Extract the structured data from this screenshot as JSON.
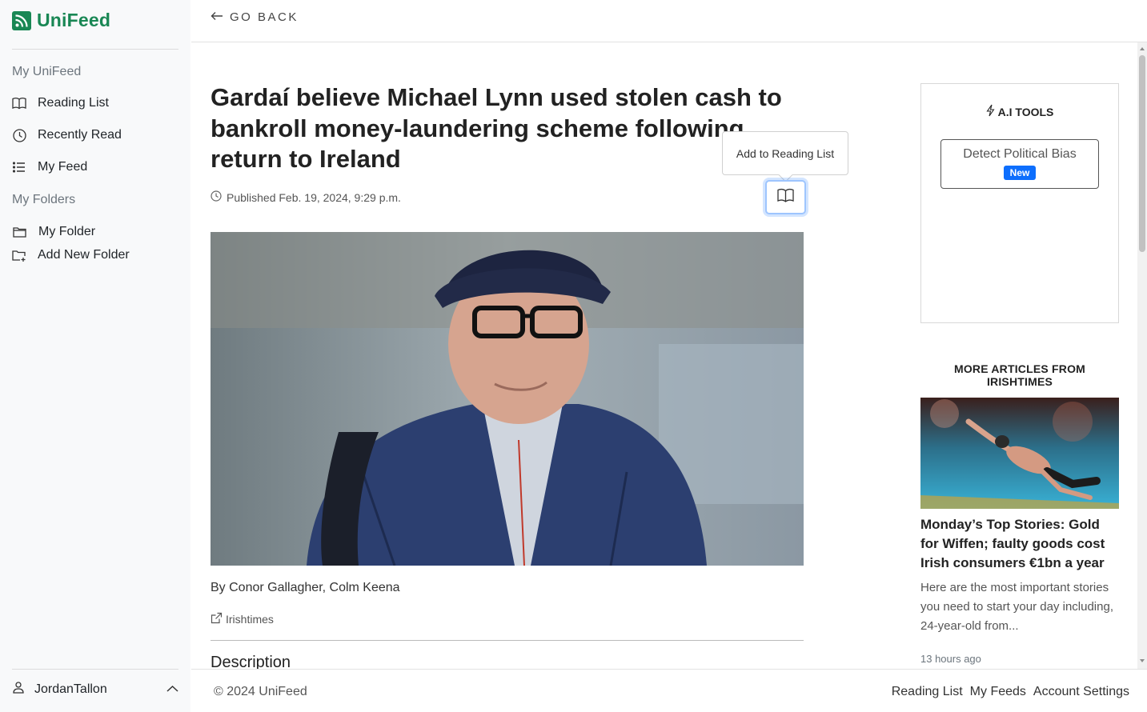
{
  "brand": {
    "name": "UniFeed",
    "color": "#198754",
    "icon": "rss-icon"
  },
  "sidebar": {
    "heading_unifeed": "My UniFeed",
    "items": [
      {
        "label": "Reading List",
        "icon": "book-icon"
      },
      {
        "label": "Recently Read",
        "icon": "clock-icon"
      },
      {
        "label": "My Feed",
        "icon": "list-icon"
      }
    ],
    "heading_folders": "My Folders",
    "folders": [
      {
        "label": "My Folder",
        "icon": "folder-icon"
      },
      {
        "label": "Add New Folder",
        "icon": "folder-plus-icon"
      }
    ],
    "user": {
      "name": "JordanTallon",
      "icon": "person-icon",
      "toggle_icon": "chevron-up-icon"
    }
  },
  "topbar": {
    "go_back": "GO BACK"
  },
  "article": {
    "title": "Gardaí believe Michael Lynn used stolen cash to bankroll money-laundering scheme following return to Ireland",
    "published": "Published Feb. 19, 2024, 9:29 p.m.",
    "tooltip": "Add to Reading List",
    "author": "By Conor Gallagher, Colm Keena",
    "source": "Irishtimes",
    "description_heading": "Description"
  },
  "ai_tools": {
    "title": "A.I TOOLS",
    "bias_button": "Detect Political Bias",
    "badge": "New",
    "badge_color": "#0d6efd"
  },
  "more": {
    "heading": "MORE ARTICLES FROM IRISHTIMES",
    "title": "Monday’s Top Stories: Gold for Wiffen; faulty goods cost Irish consumers €1bn a year",
    "description": "Here are the most important stories you need to start your day including, 24-year-old from...",
    "time": "13 hours ago"
  },
  "footer": {
    "copyright": "© 2024 UniFeed",
    "links": [
      "Reading List",
      "My Feeds",
      "Account Settings"
    ]
  }
}
